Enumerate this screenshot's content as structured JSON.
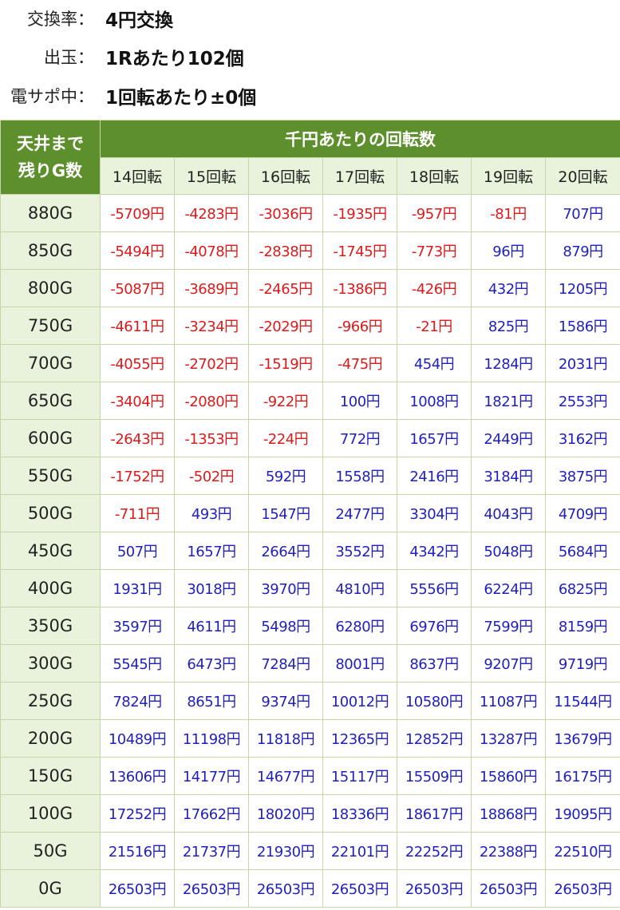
{
  "info": {
    "rows": [
      {
        "label": "交換率：",
        "value": "4円交換"
      },
      {
        "label": "出玉：",
        "value": "1Rあたり102個"
      },
      {
        "label": "電サポ中：",
        "value": "1回転あたり±0個"
      }
    ]
  },
  "table": {
    "corner_line1": "天井まで",
    "corner_line2": "残りG数",
    "group_header": "千円あたりの回転数",
    "rates": [
      "14回転",
      "15回転",
      "16回転",
      "17回転",
      "18回転",
      "19回転",
      "20回転"
    ],
    "rows": [
      {
        "g": "880G",
        "values": [
          "-5709円",
          "-4283円",
          "-3036円",
          "-1935円",
          "-957円",
          "-81円",
          "707円"
        ]
      },
      {
        "g": "850G",
        "values": [
          "-5494円",
          "-4078円",
          "-2838円",
          "-1745円",
          "-773円",
          "96円",
          "879円"
        ]
      },
      {
        "g": "800G",
        "values": [
          "-5087円",
          "-3689円",
          "-2465円",
          "-1386円",
          "-426円",
          "432円",
          "1205円"
        ]
      },
      {
        "g": "750G",
        "values": [
          "-4611円",
          "-3234円",
          "-2029円",
          "-966円",
          "-21円",
          "825円",
          "1586円"
        ]
      },
      {
        "g": "700G",
        "values": [
          "-4055円",
          "-2702円",
          "-1519円",
          "-475円",
          "454円",
          "1284円",
          "2031円"
        ]
      },
      {
        "g": "650G",
        "values": [
          "-3404円",
          "-2080円",
          "-922円",
          "100円",
          "1008円",
          "1821円",
          "2553円"
        ]
      },
      {
        "g": "600G",
        "values": [
          "-2643円",
          "-1353円",
          "-224円",
          "772円",
          "1657円",
          "2449円",
          "3162円"
        ]
      },
      {
        "g": "550G",
        "values": [
          "-1752円",
          "-502円",
          "592円",
          "1558円",
          "2416円",
          "3184円",
          "3875円"
        ]
      },
      {
        "g": "500G",
        "values": [
          "-711円",
          "493円",
          "1547円",
          "2477円",
          "3304円",
          "4043円",
          "4709円"
        ]
      },
      {
        "g": "450G",
        "values": [
          "507円",
          "1657円",
          "2664円",
          "3552円",
          "4342円",
          "5048円",
          "5684円"
        ]
      },
      {
        "g": "400G",
        "values": [
          "1931円",
          "3018円",
          "3970円",
          "4810円",
          "5556円",
          "6224円",
          "6825円"
        ]
      },
      {
        "g": "350G",
        "values": [
          "3597円",
          "4611円",
          "5498円",
          "6280円",
          "6976円",
          "7599円",
          "8159円"
        ]
      },
      {
        "g": "300G",
        "values": [
          "5545円",
          "6473円",
          "7284円",
          "8001円",
          "8637円",
          "9207円",
          "9719円"
        ]
      },
      {
        "g": "250G",
        "values": [
          "7824円",
          "8651円",
          "9374円",
          "10012円",
          "10580円",
          "11087円",
          "11544円"
        ]
      },
      {
        "g": "200G",
        "values": [
          "10489円",
          "11198円",
          "11818円",
          "12365円",
          "12852円",
          "13287円",
          "13679円"
        ]
      },
      {
        "g": "150G",
        "values": [
          "13606円",
          "14177円",
          "14677円",
          "15117円",
          "15509円",
          "15860円",
          "16175円"
        ]
      },
      {
        "g": "100G",
        "values": [
          "17252円",
          "17662円",
          "18020円",
          "18336円",
          "18617円",
          "18868円",
          "19095円"
        ]
      },
      {
        "g": "50G",
        "values": [
          "21516円",
          "21737円",
          "21930円",
          "22101円",
          "22252円",
          "22388円",
          "22510円"
        ]
      },
      {
        "g": "0G",
        "values": [
          "26503円",
          "26503円",
          "26503円",
          "26503円",
          "26503円",
          "26503円",
          "26503円"
        ]
      }
    ]
  },
  "colors": {
    "header_bg": "#5e8f2d",
    "light_bg": "#e9f3dc",
    "negative": "#dd1a1a",
    "positive": "#1f1fbf"
  }
}
